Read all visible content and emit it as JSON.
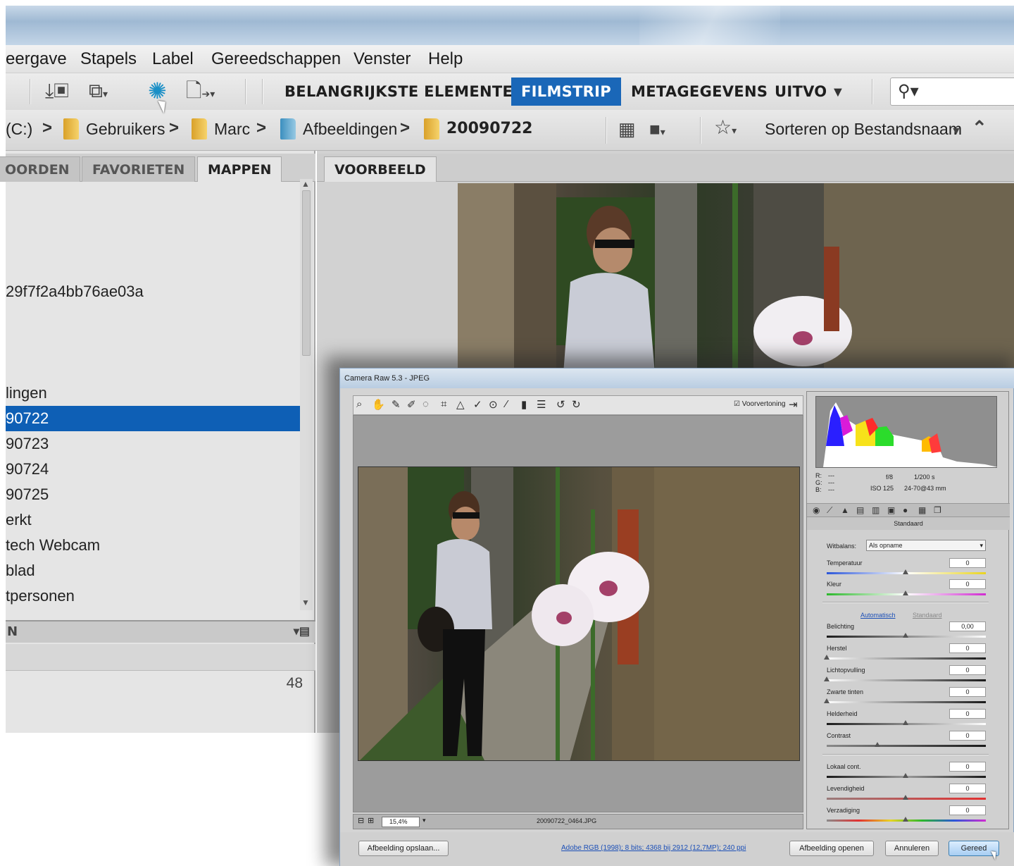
{
  "menu": [
    "eergave",
    "Stapels",
    "Label",
    "Gereedschappen",
    "Venster",
    "Help"
  ],
  "toolbar": {
    "workspaces": [
      "BELANGRIJKSTE ELEMENTEN",
      "FILMSTRIP",
      "METAGEGEVENS",
      "UITVO"
    ],
    "active_workspace": "FILMSTRIP",
    "search_placeholder": ""
  },
  "path": {
    "drive": "(C:)",
    "crumbs": [
      "Gebruikers",
      "Marc",
      "Afbeeldingen",
      "20090722"
    ],
    "sort_label": "Sorteren op Bestandsnaam"
  },
  "left_panel": {
    "tabs": [
      "OORDEN",
      "FAVORIETEN",
      "MAPPEN"
    ],
    "active_tab": "MAPPEN",
    "items": [
      "29f7f2a4bb76ae03a",
      "lingen",
      "90722",
      "90723",
      "90724",
      "90725",
      "erkt",
      "tech Webcam",
      "blad",
      "tpersonen"
    ],
    "selected": "90722",
    "subpanel_label": "N",
    "count": "48"
  },
  "preview": {
    "tab": "VOORBEELD"
  },
  "camera_raw": {
    "title": "Camera Raw 5.3  -  JPEG",
    "preview_checkbox": "Voorvertoning",
    "zoom": "15,4%",
    "filename": "20090722_0464.JPG",
    "workflow_link": "Adobe RGB (1998); 8 bits; 4368 bij 2912 (12,7MP); 240 ppi",
    "buttons": {
      "save": "Afbeelding opslaan...",
      "open": "Afbeelding openen",
      "cancel": "Annuleren",
      "done": "Gereed"
    },
    "info": {
      "rgb": [
        "R:",
        "G:",
        "B:"
      ],
      "rgb_values": [
        "---",
        "---",
        "---"
      ],
      "aperture": "f/8",
      "shutter": "1/200 s",
      "iso": "ISO 125",
      "lens": "24-70@43 mm"
    },
    "panel_title": "Standaard",
    "white_balance_label": "Witbalans:",
    "white_balance_value": "Als opname",
    "auto_label": "Automatisch",
    "default_label": "Standaard",
    "sliders": [
      {
        "label": "Temperatuur",
        "value": "0"
      },
      {
        "label": "Kleur",
        "value": "0"
      },
      {
        "label": "Belichting",
        "value": "0,00"
      },
      {
        "label": "Herstel",
        "value": "0"
      },
      {
        "label": "Lichtopvulling",
        "value": "0"
      },
      {
        "label": "Zwarte tinten",
        "value": "0"
      },
      {
        "label": "Helderheid",
        "value": "0"
      },
      {
        "label": "Contrast",
        "value": "0"
      },
      {
        "label": "Lokaal cont.",
        "value": "0"
      },
      {
        "label": "Levendigheid",
        "value": "0"
      },
      {
        "label": "Verzadiging",
        "value": "0"
      }
    ]
  },
  "colors": {
    "accent": "#1a67b8",
    "selected_row": "#0e5fb5",
    "link": "#1b4fb7"
  }
}
